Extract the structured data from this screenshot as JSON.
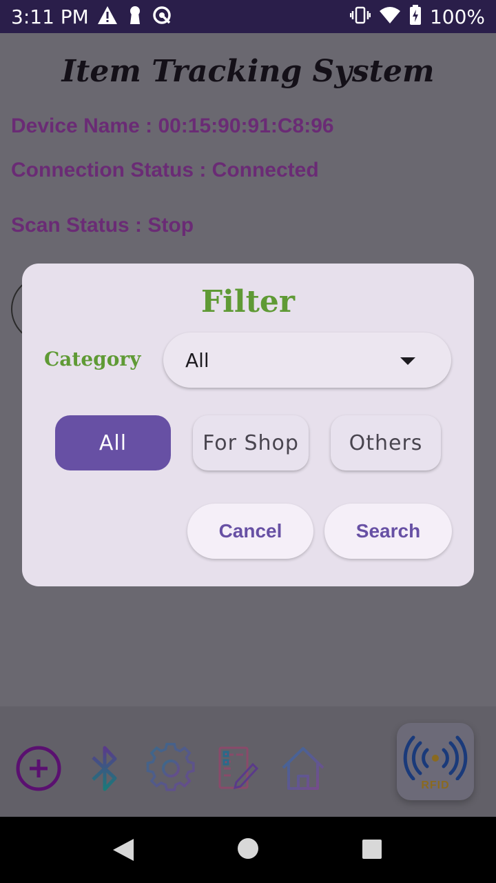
{
  "status_bar": {
    "time": "3:11 PM",
    "battery": "100%",
    "left_icons": [
      "warning-icon",
      "keyhole-icon",
      "sync-circle-icon"
    ],
    "right_icons": [
      "vibrate-icon",
      "wifi-icon",
      "battery-icon"
    ]
  },
  "app": {
    "title": "Item Tracking System",
    "device_name": "Device Name :  00:15:90:91:C8:96",
    "connection_status": "Connection Status :  Connected",
    "scan_status": "Scan Status : Stop",
    "info_color": "#6a2b75"
  },
  "dialog": {
    "title": "Filter",
    "category_label": "Category",
    "dropdown_value": "All",
    "chips": [
      {
        "label": "All",
        "selected": true
      },
      {
        "label": "For Shop",
        "selected": false
      },
      {
        "label": "Others",
        "selected": false
      }
    ],
    "cancel_label": "Cancel",
    "search_label": "Search",
    "accent_color": "#6750a4",
    "title_color": "#5f9a35"
  },
  "toolbar": {
    "icons": [
      "add-circle-icon",
      "bluetooth-icon",
      "settings-gear-icon",
      "document-edit-icon",
      "home-icon"
    ],
    "rfid_label": "RFID"
  },
  "nav": {
    "icons": [
      "back-triangle-icon",
      "home-circle-icon",
      "recents-square-icon"
    ]
  }
}
